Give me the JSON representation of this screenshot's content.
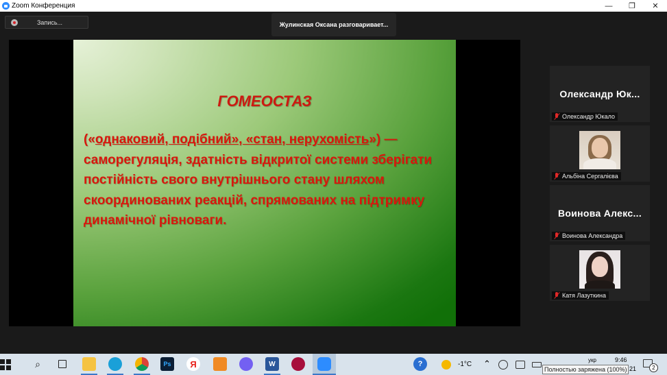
{
  "window": {
    "title": "Zoom Конференция",
    "minimize": "—",
    "restore": "❐",
    "close": "✕"
  },
  "recording": {
    "label": "Запись..."
  },
  "speaking_banner": "Жулинская Оксана разговаривает...",
  "slide": {
    "title": "ГОМЕОСТАЗ",
    "body_open": "(«",
    "body_underlined": "однаковий, подібний», «стан, нерухомість",
    "body_rest": "») — саморегуляція, здатність відкритої системи зберігати постійність свого внутрішнього стану шляхом скоординованих реакцій, спрямованих на підтримку динамічної рівноваги."
  },
  "participants": [
    {
      "display": "Олександр Юк...",
      "label": "Олександр Юкало",
      "video": false,
      "muted": true
    },
    {
      "display": "",
      "label": "Альбіна Сергалієва",
      "video": true,
      "muted": true
    },
    {
      "display": "Воинова Алекс...",
      "label": "Воинова Александра",
      "video": false,
      "muted": true
    },
    {
      "display": "",
      "label": "Катя Лазуткина",
      "video": true,
      "muted": true
    }
  ],
  "taskbar": {
    "apps": [
      "file-explorer",
      "edge",
      "chrome",
      "photoshop",
      "yandex",
      "app-orange",
      "viber",
      "word",
      "opera",
      "zoom"
    ],
    "weather": "-1°C",
    "clock_time": "9:46",
    "clock_partial": "21",
    "lang_partial": "укр",
    "notifications": "2",
    "battery_tooltip": "Полностью заряжена (100%)"
  }
}
